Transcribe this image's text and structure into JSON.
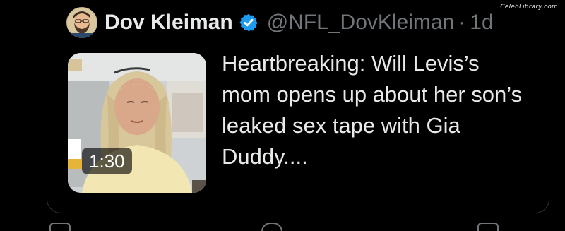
{
  "watermark": "CelebLibrary.com",
  "tweet": {
    "author": {
      "display_name": "Dov Kleiman",
      "handle": "@NFL_DovKleiman",
      "separator": "·",
      "timestamp": "1d",
      "verified": true,
      "avatar_icon": "bearded-man-avatar"
    },
    "text": "Heartbreaking: Will Levis’s mom opens up about her son’s leaked sex tape with Gia Duddy....",
    "media": {
      "type": "video",
      "duration": "1:30",
      "icon": "video-thumbnail"
    }
  },
  "colors": {
    "background": "#000000",
    "text_primary": "#e7e9ea",
    "text_secondary": "#71767b",
    "verified_blue": "#1d9bf0",
    "border": "#2f3336"
  }
}
